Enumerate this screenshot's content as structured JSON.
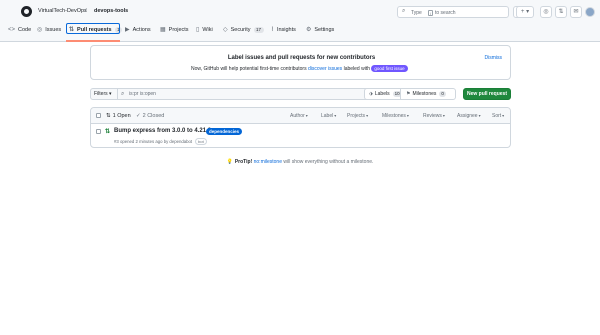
{
  "header": {
    "owner": "VirtualTech-DevOps",
    "separator": "/",
    "repo": "devops-tools",
    "search_placeholder": "Type",
    "search_key": "/",
    "search_suffix": "to search",
    "buttons": {
      "copilot": "◉ ▾",
      "add": "+ ▾",
      "issues": "◎",
      "prs": "⇅",
      "inbox": "✉"
    }
  },
  "tabs": [
    {
      "label": "Code",
      "icon": "code-icon",
      "glyph": "<>"
    },
    {
      "label": "Issues",
      "icon": "issue-icon",
      "glyph": "◎"
    },
    {
      "label": "Pull requests",
      "icon": "pull-request-icon",
      "glyph": "⇅",
      "count": "1"
    },
    {
      "label": "Actions",
      "icon": "play-icon",
      "glyph": "▶"
    },
    {
      "label": "Projects",
      "icon": "table-icon",
      "glyph": "▦"
    },
    {
      "label": "Wiki",
      "icon": "book-icon",
      "glyph": "▯"
    },
    {
      "label": "Security",
      "icon": "shield-icon",
      "glyph": "◇",
      "count": "17"
    },
    {
      "label": "Insights",
      "icon": "graph-icon",
      "glyph": "⌇"
    },
    {
      "label": "Settings",
      "icon": "gear-icon",
      "glyph": "⚙"
    }
  ],
  "banner": {
    "title": "Label issues and pull requests for new contributors",
    "desc_prefix": "Now, GitHub will help potential first-time contributors",
    "desc_link": "discover issues",
    "desc_middle": "labeled with",
    "label": "good first issue",
    "dismiss": "Dismiss"
  },
  "filters": {
    "button": "Filters ▾",
    "query": "is:pr is:open",
    "labels_label": "Labels",
    "labels_count": "10",
    "milestones_label": "Milestones",
    "milestones_count": "0",
    "new_pr": "New pull request"
  },
  "list": {
    "open_label": "1 Open",
    "closed_label": "2 Closed",
    "columns": [
      "Author",
      "Label",
      "Projects",
      "Milestones",
      "Reviews",
      "Assignee",
      "Sort"
    ],
    "items": [
      {
        "title": "Bump express from 3.0.0 to 4.21.2",
        "label": "dependencies",
        "meta": "#3 opened 2 minutes ago by dependabot",
        "bot": "bot"
      }
    ]
  },
  "protip": {
    "bold": "ProTip!",
    "link": "no:milestone",
    "suffix": "will show everything without a milestone."
  },
  "colors": {
    "accent": "#0969da",
    "green": "#1f883d",
    "tab_underline": "#fd8c73",
    "dependencies_label": "#0366d6",
    "good_first_issue_label": "#7057ff"
  }
}
